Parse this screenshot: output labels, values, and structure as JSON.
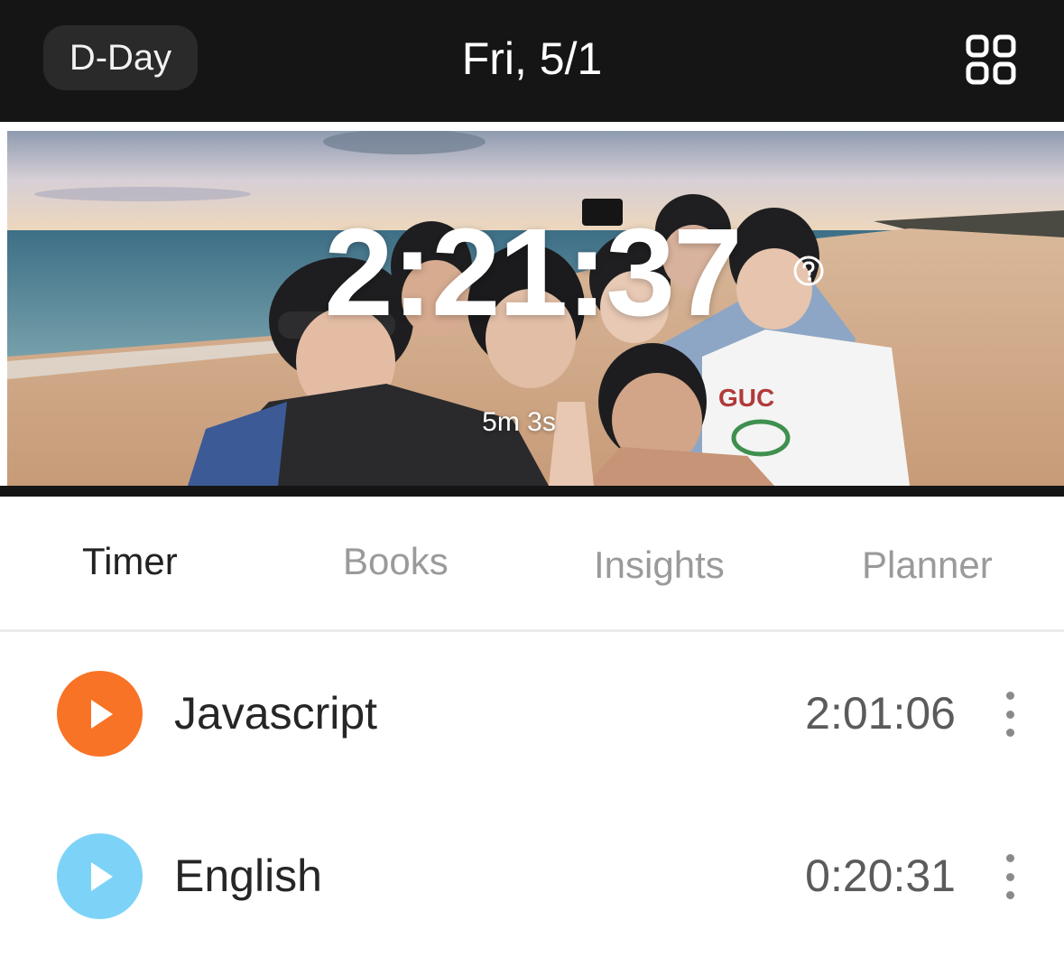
{
  "header": {
    "dday_label": "D-Day",
    "date": "Fri, 5/1",
    "grid_icon": "grid-icon"
  },
  "banner": {
    "total_time": "2:21:37",
    "break_time": "5m 3s",
    "help_icon": "question-circle-icon",
    "background_image": "beach-group-selfie-photo"
  },
  "tabs": [
    {
      "label": "Timer",
      "active": true
    },
    {
      "label": "Books",
      "active": false
    },
    {
      "label": "Insights",
      "active": false
    },
    {
      "label": "Planner",
      "active": false
    }
  ],
  "subjects": [
    {
      "name": "Javascript",
      "time": "2:01:06",
      "color": "#F97326",
      "icon": "play-icon"
    },
    {
      "name": "English",
      "time": "0:20:31",
      "color": "#7DD3F7",
      "icon": "play-icon"
    }
  ],
  "colors": {
    "header_bg": "#151515",
    "active_tab": "#222222",
    "inactive_tab": "#9A9A9A"
  }
}
